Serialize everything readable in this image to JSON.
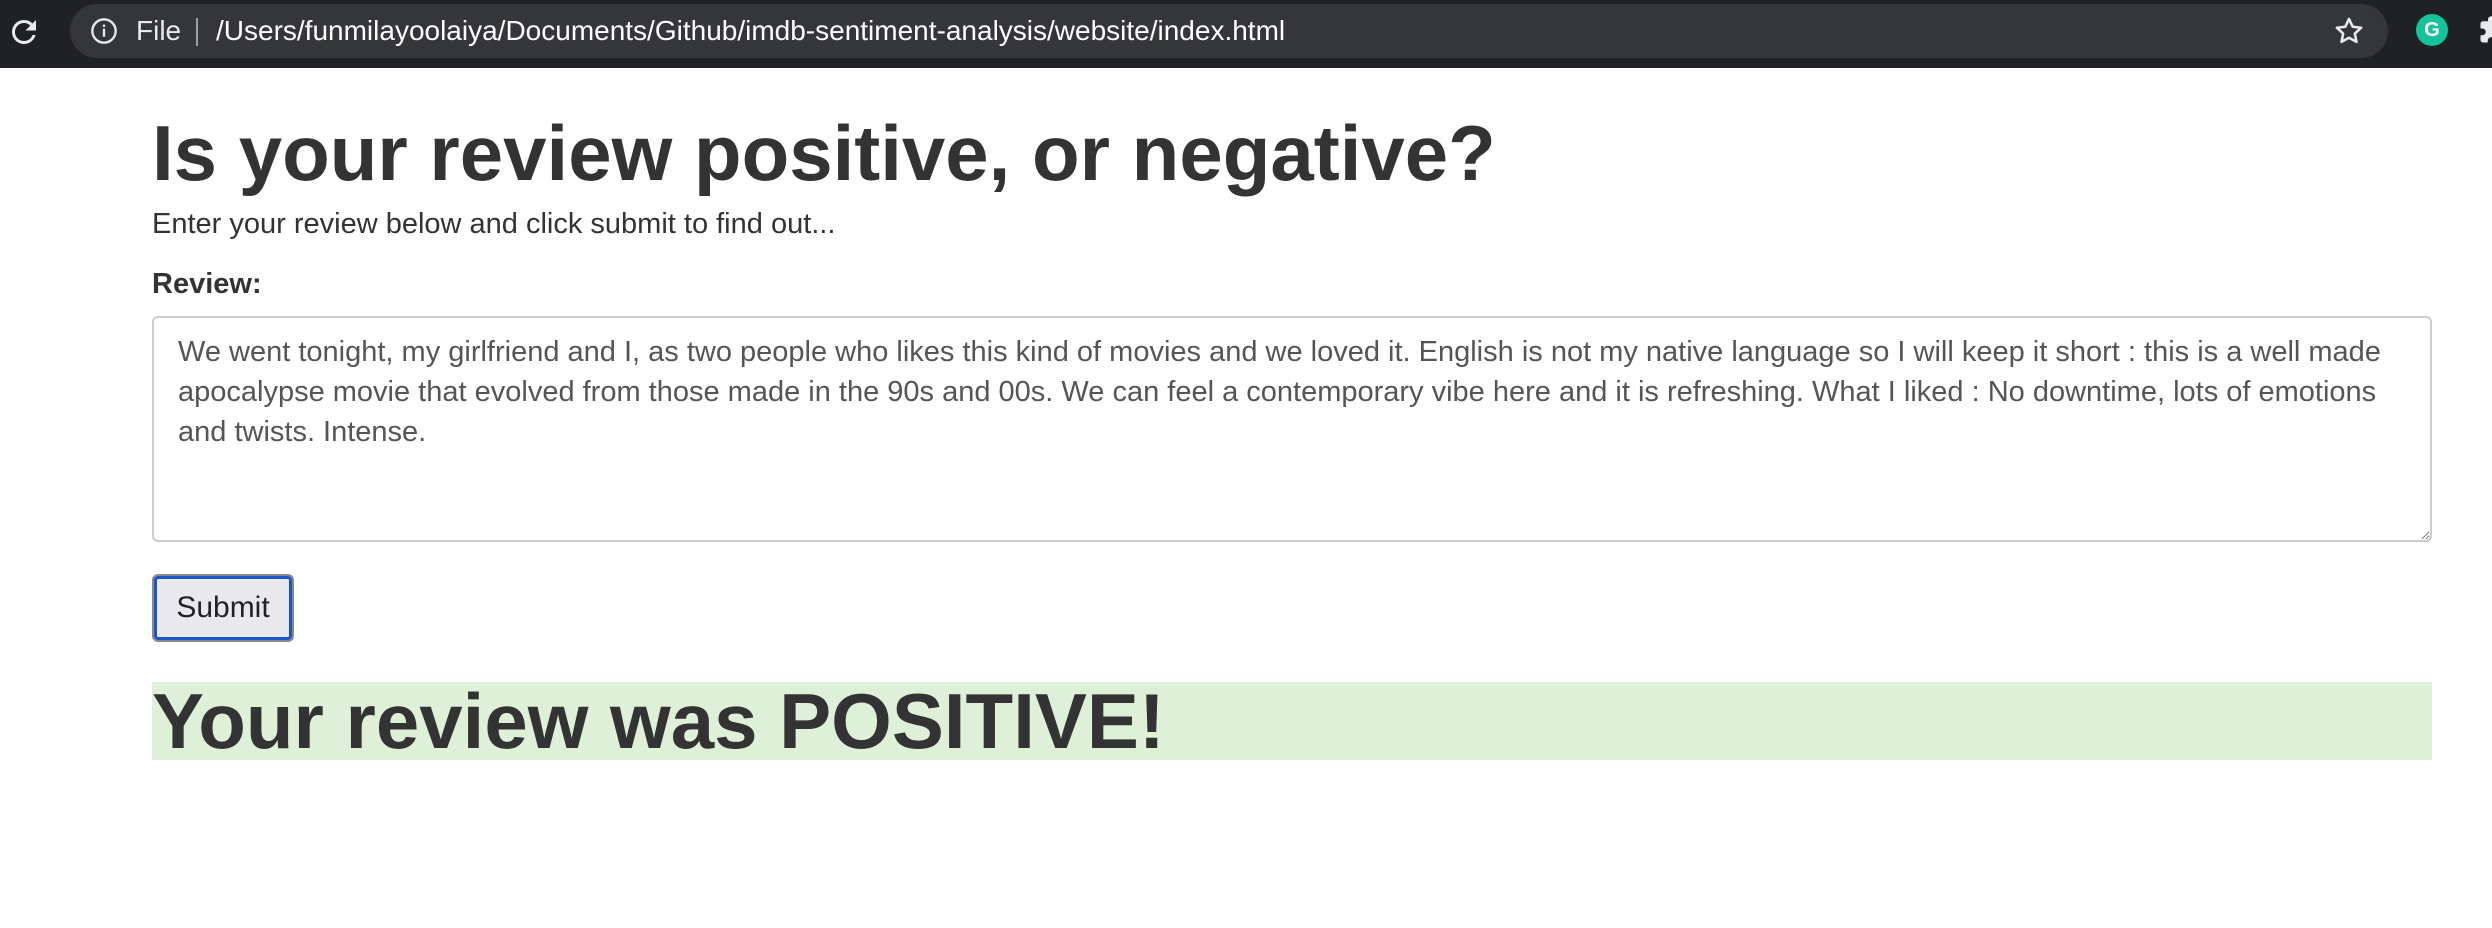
{
  "browser": {
    "scheme_label": "File",
    "url": "/Users/funmilayoolaiya/Documents/Github/imdb-sentiment-analysis/website/index.html",
    "icons": [
      "reload-icon",
      "info-icon",
      "star-icon",
      "grammarly-extension-icon",
      "extensions-puzzle-icon"
    ],
    "grammarly_letter": "G"
  },
  "page": {
    "title": "Is your review positive, or negative?",
    "lead": "Enter your review below and click submit to find out...",
    "review_label": "Review:",
    "review_text": "We went tonight, my girlfriend and I, as two people who likes this kind of movies and we loved it. English is not my native language so I will keep it short : this is a well made apocalypse movie that evolved from those made in the 90s and 00s. We can feel a contemporary vibe here and it is refreshing. What I liked : No downtime, lots of emotions and twists. Intense.",
    "submit_label": "Submit",
    "result_text": "Your review was POSITIVE!"
  },
  "colors": {
    "result_background": "#dff0d8",
    "toolbar": "#202124",
    "focus_ring": "#1a56c8"
  }
}
